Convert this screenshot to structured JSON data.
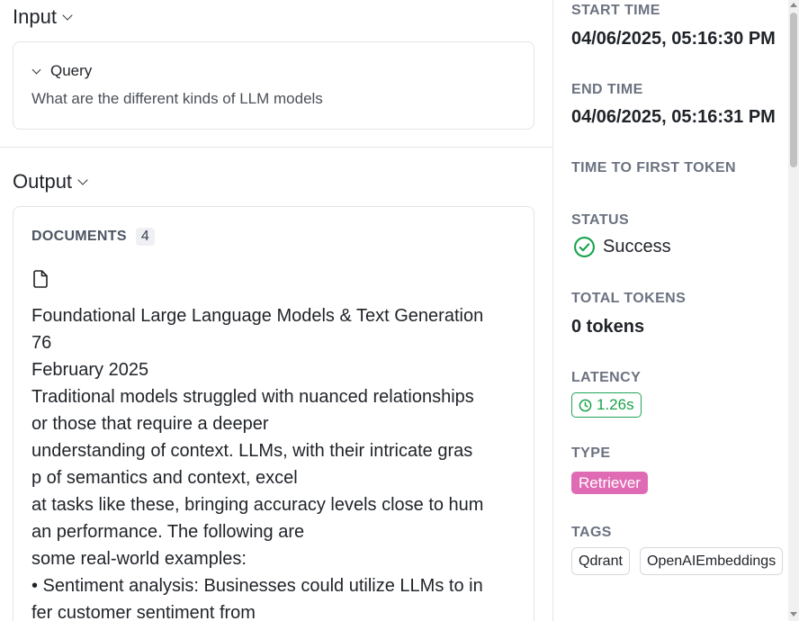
{
  "input": {
    "heading": "Input",
    "query_label": "Query",
    "query_text": "What are the different kinds of LLM models"
  },
  "output": {
    "heading": "Output",
    "documents_label": "DOCUMENTS",
    "documents_count": "4",
    "document_lines": [
      "Foundational Large Language Models & Text Generation",
      "76",
      "February 2025",
      "Traditional models struggled with nuanced relationships",
      "or those that require a deeper",
      "understanding of context. LLMs, with their intricate gras",
      "p of semantics and context, excel",
      "at tasks like these, bringing accuracy levels close to hum",
      "an performance. The following are",
      "some real-world examples:",
      "• Sentiment analysis: Businesses could utilize LLMs to in",
      "fer customer sentiment from"
    ]
  },
  "details": {
    "start_time_label": "START TIME",
    "start_time": "04/06/2025, 05:16:30 PM",
    "end_time_label": "END TIME",
    "end_time": "04/06/2025, 05:16:31 PM",
    "ttft_label": "TIME TO FIRST TOKEN",
    "status_label": "STATUS",
    "status": "Success",
    "total_tokens_label": "TOTAL TOKENS",
    "total_tokens": "0 tokens",
    "latency_label": "LATENCY",
    "latency": "1.26s",
    "type_label": "TYPE",
    "type": "Retriever",
    "tags_label": "TAGS",
    "tags": [
      "Qdrant",
      "OpenAIEmbeddings"
    ]
  },
  "icons": [
    "chevron-down-icon",
    "file-icon",
    "check-circle-icon",
    "clock-icon"
  ],
  "colors": {
    "success": "#16a34a",
    "retriever_badge": "#e06bb5",
    "label_gray": "#6b7280",
    "border": "#e2e4e8"
  }
}
